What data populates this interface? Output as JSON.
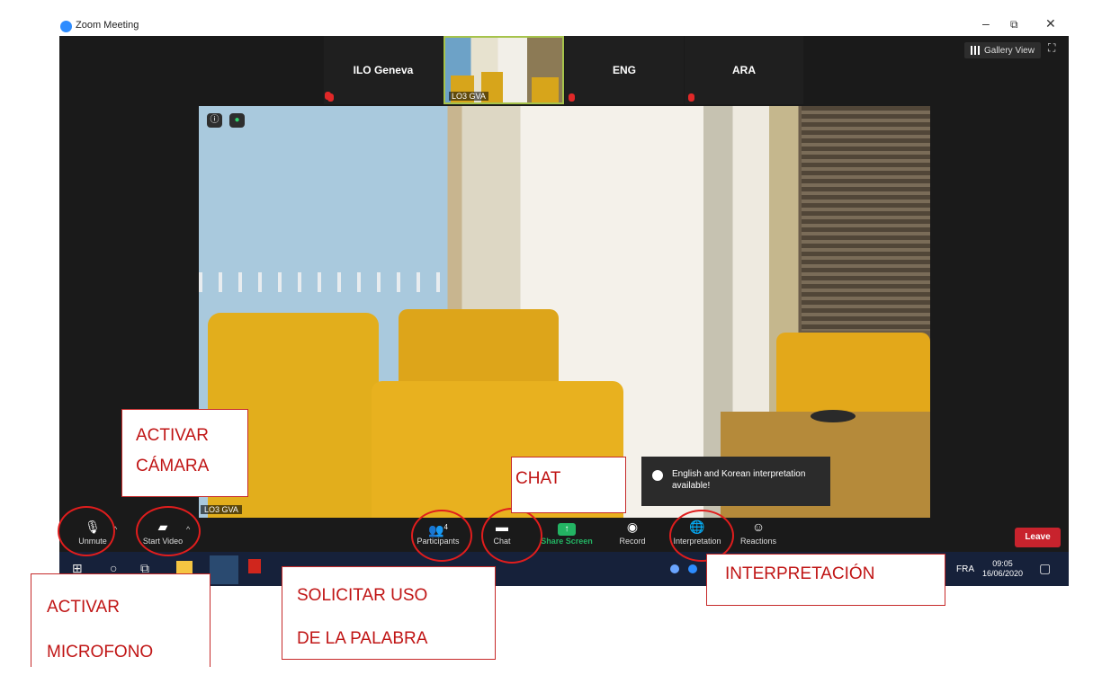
{
  "window": {
    "app_title": "Zoom Meeting",
    "minimize": "–",
    "restore": "⧉",
    "close": "✕"
  },
  "top_bar": {
    "gallery_view": "Gallery View",
    "fullscreen": "⛶"
  },
  "tiles": [
    {
      "name": "ILO Geneva"
    },
    {
      "name": "LO3 GVA"
    },
    {
      "name": "ENG"
    },
    {
      "name": "ARA"
    }
  ],
  "main_video": {
    "label": "LO3 GVA"
  },
  "toast": {
    "text": "English and Korean interpretation available!"
  },
  "toolbar": {
    "unmute": "Unmute",
    "start_video": "Start Video",
    "participants": "Participants",
    "participants_count": "4",
    "chat": "Chat",
    "share_screen": "Share Screen",
    "record": "Record",
    "interpretation": "Interpretation",
    "reactions": "Reactions",
    "leave": "Leave"
  },
  "taskbar": {
    "lang": "FRA",
    "time": "09:05",
    "date": "16/06/2020"
  },
  "annotations": {
    "activar_camara": [
      "ACTIVAR",
      "CÁMARA"
    ],
    "chat": "CHAT",
    "interpretacion": "INTERPRETACIÓN",
    "activar_microfono": [
      "ACTIVAR",
      "MICROFONO"
    ],
    "solicitar": [
      "SOLICITAR USO",
      "DE LA PALABRA"
    ]
  },
  "colors": {
    "accent": "#2d8cff",
    "annotation_red": "#e01d1d",
    "leave_red": "#c8232d",
    "share_green": "#23b463"
  }
}
